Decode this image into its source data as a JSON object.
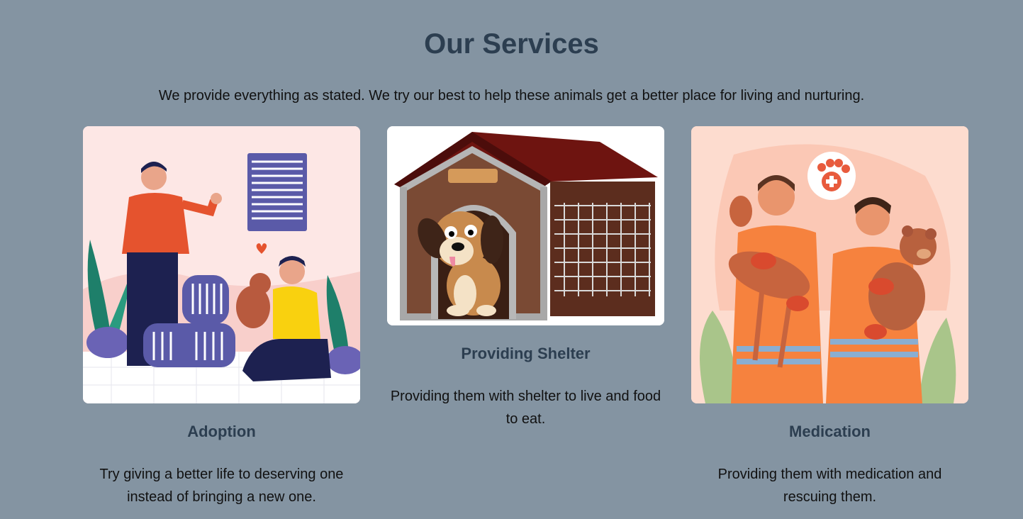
{
  "section": {
    "title": "Our Services",
    "subtitle": "We provide everything as stated. We try our best to help these animals get a better place for living and nurturing."
  },
  "cards": [
    {
      "title": "Adoption",
      "description": "Try giving a better life to deserving one instead of bringing a new one.",
      "image": "adoption-illustration"
    },
    {
      "title": "Providing Shelter",
      "description": "Providing them with shelter to live and food to eat.",
      "image": "dog-house-illustration"
    },
    {
      "title": "Medication",
      "description": "Providing them with medication and rescuing them.",
      "image": "rescue-workers-illustration"
    }
  ],
  "colors": {
    "background": "#8494a2",
    "heading": "#2c3e50",
    "text": "#111111"
  }
}
